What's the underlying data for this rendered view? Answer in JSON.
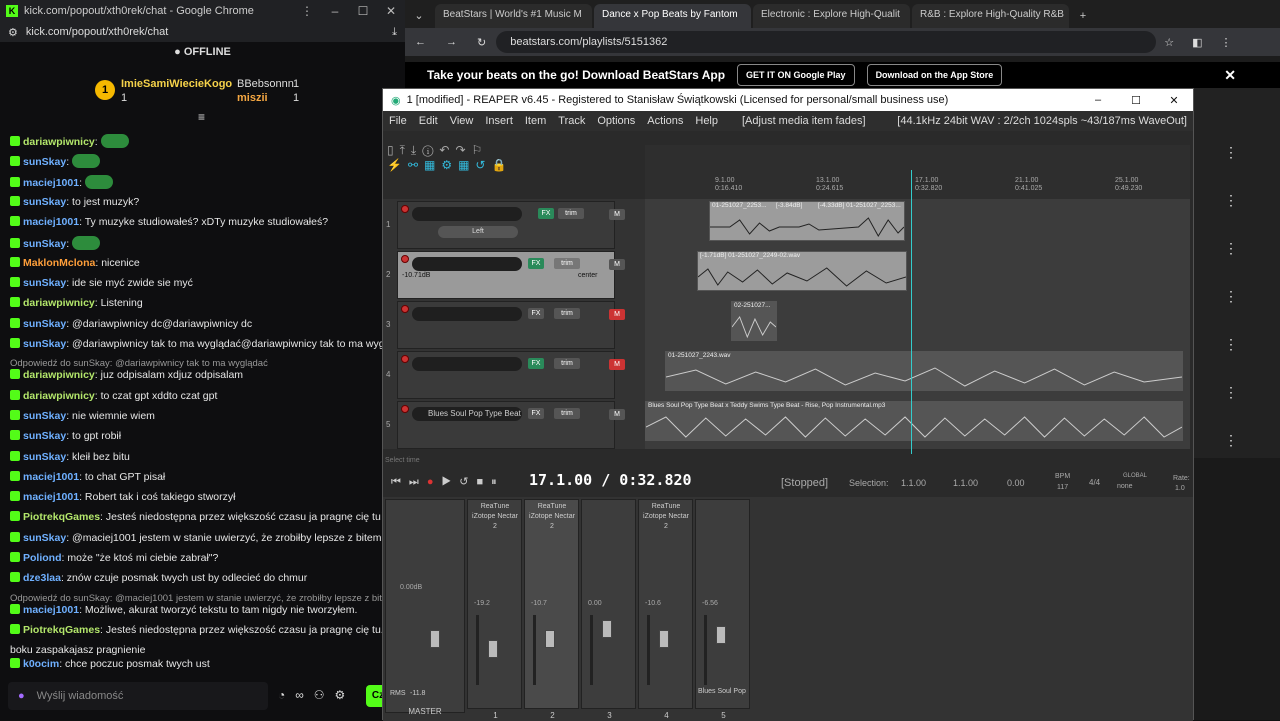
{
  "left_window": {
    "title": "kick.com/popout/xth0rek/chat - Google Chrome",
    "address": "kick.com/popout/xth0rek/chat",
    "status": "OFFLINE",
    "leaderboard": [
      {
        "name": "ImieSamiWiecieKogo",
        "count": "1"
      },
      {
        "name": "BBebsonnn",
        "count": "1"
      },
      {
        "name": "miszii",
        "count": "1"
      }
    ],
    "messages": [
      {
        "user": "dariawpiwnicy",
        "text": "",
        "color": "#b3e66b"
      },
      {
        "user": "sunSkay",
        "text": "",
        "color": "#6fb0ff"
      },
      {
        "user": "maciej1001",
        "text": "",
        "color": "#6fb0ff"
      },
      {
        "user": "sunSkay",
        "text": "to jest muzyk?",
        "color": "#6fb0ff"
      },
      {
        "user": "maciej1001",
        "text": "Ty muzyke studiowałeś? xDTy muzyke studiowałeś?",
        "color": "#6fb0ff"
      },
      {
        "user": "sunSkay",
        "text": "",
        "color": "#6fb0ff"
      },
      {
        "user": "MaklonMclona",
        "text": "nicenice",
        "color": "#ff9f3a"
      },
      {
        "user": "sunSkay",
        "text": "ide sie myć zwide sie myć",
        "color": "#6fb0ff"
      },
      {
        "user": "dariawpiwnicy",
        "text": "Listening",
        "color": "#b3e66b"
      },
      {
        "user": "sunSkay",
        "text": "@dariawpiwnicy dc@dariawpiwnicy dc",
        "color": "#6fb0ff"
      },
      {
        "user": "sunSkay",
        "text": "@dariawpiwnicy tak to ma wyglądać@dariawpiwnicy tak to ma wyglądać",
        "color": "#6fb0ff"
      },
      {
        "user": "dariawpiwnicy",
        "text": "juz odpisalam xdjuz odpisalam",
        "color": "#b3e66b",
        "reply": "Odpowiedź do sunSkay: @dariawpiwnicy tak to ma wyglądać"
      },
      {
        "user": "dariawpiwnicy",
        "text": "to czat gpt xddto czat gpt",
        "color": "#b3e66b"
      },
      {
        "user": "sunSkay",
        "text": "nie wiemnie wiem",
        "color": "#6fb0ff"
      },
      {
        "user": "sunSkay",
        "text": "to gpt robił",
        "color": "#6fb0ff"
      },
      {
        "user": "sunSkay",
        "text": "kleił bez bitu",
        "color": "#6fb0ff"
      },
      {
        "user": "maciej1001",
        "text": "to chat GPT pisał",
        "color": "#6fb0ff"
      },
      {
        "user": "maciej1001",
        "text": "Robert tak   i coś takiego stworzył",
        "color": "#6fb0ff"
      },
      {
        "user": "PiotrekqGames",
        "text": "Jesteś niedostępna przez większość czasu ja pragnę cię tu",
        "color": "#b3e66b"
      },
      {
        "user": "sunSkay",
        "text": "@maciej1001 jestem w stanie uwierzyć, że zrobiłby lepsze z bitem",
        "color": "#6fb0ff"
      },
      {
        "user": "Poliond",
        "text": "może \"że ktoś mi ciebie zabrał\"?",
        "color": "#6fb0ff"
      },
      {
        "user": "dze3laa",
        "text": "znów czuje posmak twych ust by odlecieć do chmur",
        "color": "#6fb0ff"
      },
      {
        "user": "maciej1001",
        "text": "Możliwe, akurat tworzyć tekstu to tam nigdy nie tworzyłem.",
        "color": "#6fb0ff",
        "reply": "Odpowiedź do sunSkay: @maciej1001 jestem w stanie uwierzyć, że zrobiłby lepsze z bitem"
      },
      {
        "user": "PiotrekqGames",
        "text": "Jesteś niedostępna przez większość czasu ja pragnę cię tu. U mego",
        "color": "#b3e66b"
      },
      {
        "user": "",
        "text": "boku zaspakajasz pragnienie",
        "color": "#b3e66b"
      },
      {
        "user": "k0ocim",
        "text": "chce poczuc posmak twych ust",
        "color": "#6fb0ff"
      }
    ],
    "input_placeholder": "Wyślij wiadomość",
    "send_label": "Cz"
  },
  "browser": {
    "tabs": [
      "BeatStars | World's #1 Music M",
      "Dance x Pop Beats by Fantom",
      "Electronic : Explore High-Qualit",
      "R&B : Explore High-Quality R&B"
    ],
    "address": "beatstars.com/playlists/5151362",
    "promo": "Take your beats on the go! Download BeatStars App",
    "google_play": "GET IT ON Google Play",
    "app_store": "Download on the App Store"
  },
  "reaper": {
    "title": "1 [modified] - REAPER v6.45 - Registered to Stanisław Świątkowski (Licensed for personal/small business use)",
    "menu": [
      "File",
      "Edit",
      "View",
      "Insert",
      "Item",
      "Track",
      "Options",
      "Actions",
      "Help",
      "[Adjust media item fades]"
    ],
    "status_right": "[44.1kHz 24bit WAV : 2/2ch 1024spls ~43/187ms WaveOut]",
    "ruler": [
      {
        "bar": "9.1.00",
        "time": "0:16.410"
      },
      {
        "bar": "13.1.00",
        "time": "0:24.615"
      },
      {
        "bar": "17.1.00",
        "time": "0:32.820"
      },
      {
        "bar": "21.1.00",
        "time": "0:41.025"
      },
      {
        "bar": "25.1.00",
        "time": "0:49.230"
      }
    ],
    "tracks": [
      {
        "num": "1",
        "name": "",
        "pan": "Left",
        "vol": ""
      },
      {
        "num": "2",
        "name": "",
        "pan": "center",
        "vol": "-10.71dB"
      },
      {
        "num": "3",
        "name": "",
        "pan": "",
        "vol": ""
      },
      {
        "num": "4",
        "name": "",
        "pan": "",
        "vol": ""
      },
      {
        "num": "5",
        "name": "Blues Soul Pop Type Beat",
        "pan": "",
        "vol": ""
      }
    ],
    "items": [
      {
        "label": "01-251027_2253..."
      },
      {
        "label": "[-3.84dB]"
      },
      {
        "label": "[-4.33dB] 01-251027_2253..."
      },
      {
        "label": "[-1.71dB] 01-251027_2249-02.wav"
      },
      {
        "label": "02-251027..."
      },
      {
        "label": "01-251027_2243.wav"
      },
      {
        "label": "Blues Soul Pop Type Beat x Teddy Swims Type Beat - Rise, Pop Instrumental.mp3"
      }
    ],
    "transport_time": "17.1.00 / 0:32.820",
    "transport_status": "[Stopped]",
    "selection_label": "Selection:",
    "selection_values": [
      "1.1.00",
      "1.1.00",
      "0.00"
    ],
    "bpm_label": "BPM",
    "bpm": "117",
    "timesig": "4/4",
    "rate_label": "Rate:",
    "rate": "1.0",
    "global_label": "GLOBAL",
    "global_value": "none",
    "select_time": "Select time",
    "mixer": {
      "fx_names": [
        "ReaTune iZotope Nectar 2",
        "ReaTune iZotope Nectar 2",
        "",
        "ReaTune iZotope Nectar 2",
        ""
      ],
      "strips": [
        {
          "num": "1",
          "vol": "-19.2"
        },
        {
          "num": "2",
          "vol": "-10.7"
        },
        {
          "num": "3",
          "vol": "0.00"
        },
        {
          "num": "4",
          "vol": "-10.6"
        },
        {
          "num": "5",
          "vol": "-6.56",
          "name": "Blues Soul Pop"
        }
      ],
      "master_label": "MASTER",
      "master_vol": "0.00dB",
      "rms_label": "RMS",
      "rms": "-11.8"
    }
  },
  "colors": {
    "kick_green": "#53fc18",
    "reaper_item": "#9c9c9c",
    "cursor": "#33cccc"
  }
}
